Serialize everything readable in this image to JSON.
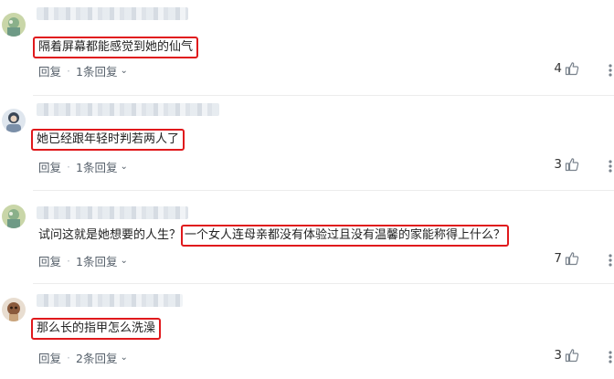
{
  "comments": [
    {
      "text": "隔着屏幕都能感觉到她的仙气",
      "prefix": "",
      "reply_label": "回复",
      "replies_label": "1条回复",
      "likes": "4"
    },
    {
      "text": "她已经跟年轻时判若两人了",
      "prefix": "",
      "reply_label": "回复",
      "replies_label": "1条回复",
      "likes": "3"
    },
    {
      "text": "一个女人连母亲都没有体验过且没有温馨的家能称得上什么？",
      "prefix": "试问这就是她想要的人生？",
      "reply_label": "回复",
      "replies_label": "1条回复",
      "likes": "7"
    },
    {
      "text": "那么长的指甲怎么洗澡",
      "prefix": "",
      "reply_label": "回复",
      "replies_label": "2条回复",
      "likes": "3"
    }
  ],
  "colors": {
    "highlight": "#e0191c",
    "action_text": "#56606b"
  },
  "icons": {
    "like": "thumbs-up-icon",
    "more": "more-icon",
    "chevron": "chevron-down-icon"
  }
}
